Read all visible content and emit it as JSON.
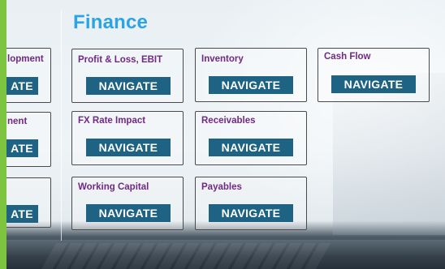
{
  "page": {
    "title": "Finance",
    "accent_color": "#2aa4e4",
    "label_color": "#6f2a82",
    "button_color": "#1f6384",
    "side_bar_color": "#7dc540"
  },
  "left_column": {
    "tiles": [
      {
        "label": "lopment",
        "button": "ATE"
      },
      {
        "label": "nent",
        "button": "ATE"
      },
      {
        "label": "",
        "button": "ATE"
      }
    ]
  },
  "tiles": {
    "profit_loss": {
      "label": "Profit & Loss, EBIT",
      "button": "NAVIGATE"
    },
    "inventory": {
      "label": "Inventory",
      "button": "NAVIGATE"
    },
    "cash_flow": {
      "label": "Cash Flow",
      "button": "NAVIGATE"
    },
    "fx_rate": {
      "label": "FX Rate Impact",
      "button": "NAVIGATE"
    },
    "receivables": {
      "label": "Receivables",
      "button": "NAVIGATE"
    },
    "working_capital": {
      "label": "Working Capital",
      "button": "NAVIGATE"
    },
    "payables": {
      "label": "Payables",
      "button": "NAVIGATE"
    }
  }
}
